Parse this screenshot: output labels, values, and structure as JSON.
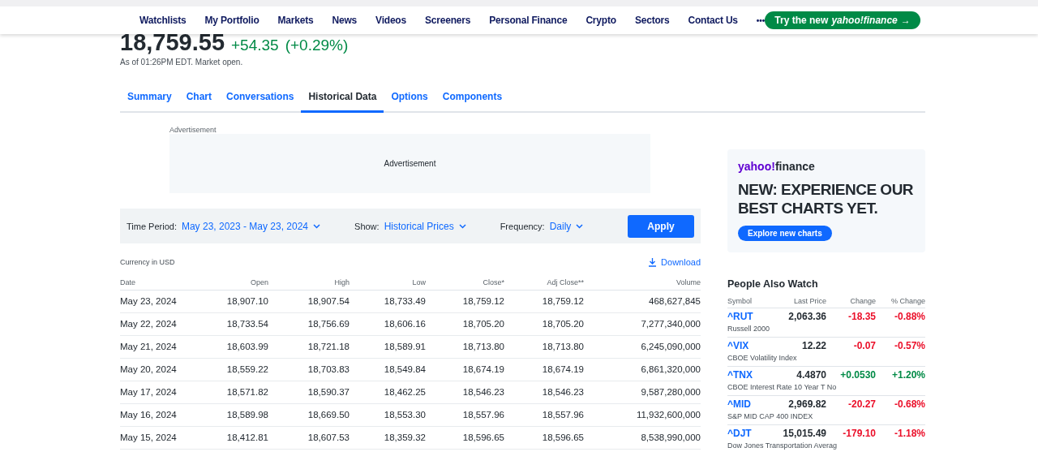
{
  "nav": {
    "items": [
      "Watchlists",
      "My Portfolio",
      "Markets",
      "News",
      "Videos",
      "Screeners",
      "Personal Finance",
      "Crypto",
      "Sectors",
      "Contact Us"
    ],
    "more": "•••",
    "cta": {
      "text": "Try the new",
      "brand_a": "yahoo!",
      "brand_b": "finance",
      "arrow": "→"
    }
  },
  "quote": {
    "price": "18,759.55",
    "change": "+54.35",
    "change_pct": "(+0.29%)",
    "color": "#008a46",
    "as_of": "As of 01:26PM EDT. Market open."
  },
  "tabs": [
    {
      "label": "Summary",
      "selected": false
    },
    {
      "label": "Chart",
      "selected": false
    },
    {
      "label": "Conversations",
      "selected": false
    },
    {
      "label": "Historical Data",
      "selected": true
    },
    {
      "label": "Options",
      "selected": false
    },
    {
      "label": "Components",
      "selected": false
    }
  ],
  "ad": {
    "label": "Advertisement",
    "text": "Advertisement"
  },
  "filters": {
    "time_period": {
      "label": "Time Period:",
      "value": "May 23, 2023 - May 23, 2024"
    },
    "show": {
      "label": "Show:",
      "value": "Historical Prices"
    },
    "frequency": {
      "label": "Frequency:",
      "value": "Daily"
    },
    "apply": "Apply"
  },
  "currency": "Currency in USD",
  "download": "Download",
  "table": {
    "columns": [
      "Date",
      "Open",
      "High",
      "Low",
      "Close*",
      "Adj Close**",
      "Volume"
    ],
    "rows": [
      [
        "May 23, 2024",
        "18,907.10",
        "18,907.54",
        "18,733.49",
        "18,759.12",
        "18,759.12",
        "468,627,845"
      ],
      [
        "May 22, 2024",
        "18,733.54",
        "18,756.69",
        "18,606.16",
        "18,705.20",
        "18,705.20",
        "7,277,340,000"
      ],
      [
        "May 21, 2024",
        "18,603.99",
        "18,721.18",
        "18,589.91",
        "18,713.80",
        "18,713.80",
        "6,245,090,000"
      ],
      [
        "May 20, 2024",
        "18,559.22",
        "18,703.83",
        "18,549.84",
        "18,674.19",
        "18,674.19",
        "6,861,320,000"
      ],
      [
        "May 17, 2024",
        "18,571.82",
        "18,590.37",
        "18,462.25",
        "18,546.23",
        "18,546.23",
        "9,587,280,000"
      ],
      [
        "May 16, 2024",
        "18,589.98",
        "18,669.50",
        "18,553.30",
        "18,557.96",
        "18,557.96",
        "11,932,600,000"
      ],
      [
        "May 15, 2024",
        "18,412.81",
        "18,607.53",
        "18,359.32",
        "18,596.65",
        "18,596.65",
        "8,538,990,000"
      ]
    ]
  },
  "promo": {
    "brand_a": "yahoo!",
    "brand_b": "finance",
    "headline": "NEW: EXPERIENCE OUR BEST CHARTS YET.",
    "button": "Explore new charts"
  },
  "watch": {
    "title": "People Also Watch",
    "columns": [
      "Symbol",
      "Last Price",
      "Change",
      "% Change"
    ],
    "rows": [
      {
        "symbol": "^RUT",
        "name": "Russell 2000",
        "price": "2,063.36",
        "change": "-18.35",
        "change_pct": "-0.88%",
        "color": "#eb0f29"
      },
      {
        "symbol": "^VIX",
        "name": "CBOE Volatility Index",
        "price": "12.22",
        "change": "-0.07",
        "change_pct": "-0.57%",
        "color": "#eb0f29"
      },
      {
        "symbol": "^TNX",
        "name": "CBOE Interest Rate 10 Year T No",
        "price": "4.4870",
        "change": "+0.0530",
        "change_pct": "+1.20%",
        "color": "#008a46"
      },
      {
        "symbol": "^MID",
        "name": "S&P MID CAP 400 INDEX",
        "price": "2,969.82",
        "change": "-20.27",
        "change_pct": "-0.68%",
        "color": "#eb0f29"
      },
      {
        "symbol": "^DJT",
        "name": "Dow Jones Transportation Averag",
        "price": "15,015.49",
        "change": "-179.10",
        "change_pct": "-1.18%",
        "color": "#eb0f29"
      }
    ]
  }
}
